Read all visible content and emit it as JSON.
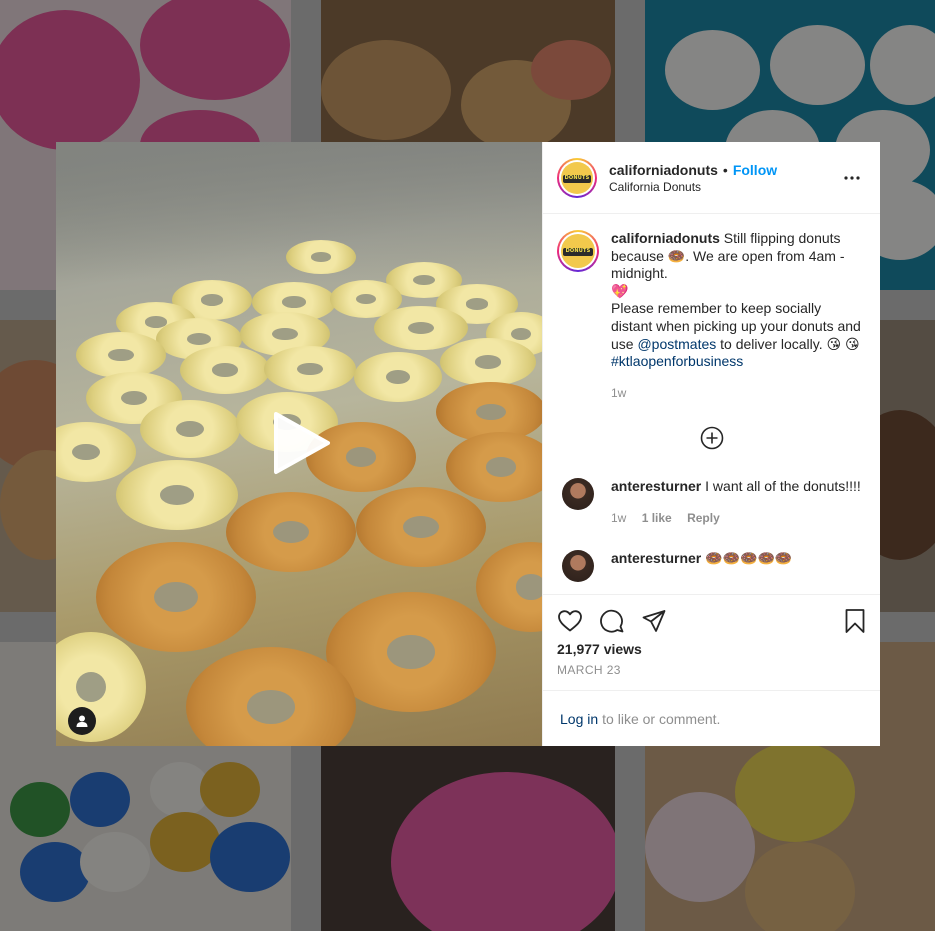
{
  "post": {
    "username": "californiadonuts",
    "separator": "•",
    "follow_label": "Follow",
    "location": "California Donuts",
    "logo_text": "DONUTS",
    "caption": {
      "username": "californiadonuts",
      "part1": "Still flipping donuts because",
      "part2": ". We are open from 4am - midnight.",
      "part3": "Please remember to keep socially distant when picking up your donuts and use",
      "mention": "@postmates",
      "part4": "to deliver locally.",
      "hashtag": "#ktlaopenforbusiness",
      "time": "1w"
    },
    "emoji": {
      "donut": "🍩",
      "heart": "💖",
      "kiss": "😘"
    },
    "comments": [
      {
        "username": "anteresturner",
        "text": "I want all of the donuts!!!!",
        "time": "1w",
        "likes": "1 like",
        "reply": "Reply"
      },
      {
        "username": "anteresturner",
        "text": "🍩🍩🍩🍩🍩"
      }
    ],
    "views": "21,977 views",
    "date": "MARCH 23",
    "login_link": "Log in",
    "login_text": "to like or comment."
  },
  "icons": {
    "more": "more-options-icon",
    "load_more": "plus-circle-icon",
    "like": "heart-icon",
    "comment": "comment-icon",
    "share": "share-icon",
    "save": "bookmark-icon",
    "play": "play-icon",
    "user_tag": "user-tag-icon"
  },
  "colors": {
    "accent": "#0095f6",
    "link": "#00376b",
    "text": "#262626",
    "muted": "#8e8e8e"
  }
}
